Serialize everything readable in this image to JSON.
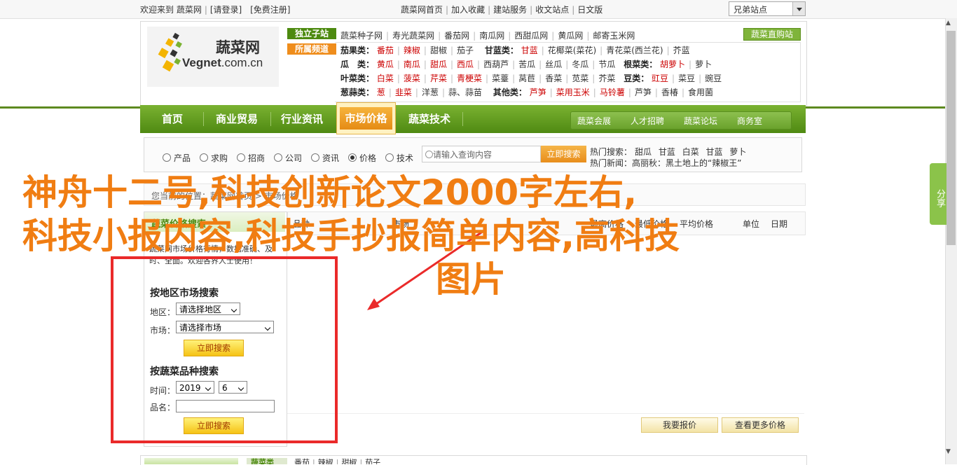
{
  "topbar": {
    "welcome": "欢迎来到 蔬菜网",
    "login": "[请登录]",
    "register": "[免费注册]",
    "links": [
      "蔬菜网首页",
      "加入收藏",
      "建站服务",
      "收文站点",
      "日文版"
    ],
    "lang_select": "兄弟站点"
  },
  "logo": {
    "cn": "蔬菜网",
    "en_a": "Vegnet",
    "en_b": ".com.cn",
    "reg": "®"
  },
  "header": {
    "tab_featured": "独立子站",
    "tab_channel": "所属频道",
    "direct": "蔬菜直购站",
    "row0": [
      "蔬菜种子网",
      "寿光蔬菜网",
      "番茄网",
      "南瓜网",
      "西甜瓜网",
      "黄瓜网",
      "邮寄玉米网"
    ],
    "rows": [
      {
        "label": "茄果类：",
        "items": [
          "番茄",
          "辣椒",
          "甜椒",
          "茄子"
        ],
        "label2": "甘蓝类：",
        "items2": [
          "甘蓝",
          "花椰菜(菜花)",
          "青花菜(西兰花)",
          "芥蓝"
        ]
      },
      {
        "label": "瓜　类：",
        "items": [
          "黄瓜",
          "南瓜",
          "甜瓜",
          "西瓜",
          "西葫芦",
          "苦瓜",
          "丝瓜",
          "冬瓜",
          "节瓜"
        ],
        "label2": "根菜类：",
        "items2": [
          "胡萝卜",
          "萝卜"
        ]
      },
      {
        "label": "叶菜类：",
        "items": [
          "白菜",
          "菠菜",
          "芹菜",
          "青梗菜",
          "菜薹",
          "莴苣",
          "香菜",
          "苋菜",
          "芥菜"
        ],
        "label2": "豆类：",
        "items2": [
          "豇豆",
          "菜豆",
          "豌豆"
        ]
      },
      {
        "label": "葱蒜类：",
        "items": [
          "葱",
          "韭菜",
          "洋葱",
          "蒜、蒜苗"
        ],
        "label2": "其他类：",
        "items2": [
          "芦笋",
          "菜用玉米",
          "马铃薯",
          "芦笋",
          "香椿",
          "食用菌"
        ]
      }
    ]
  },
  "nav": {
    "items": [
      "首页",
      "商业贸易",
      "行业资讯",
      "市场价格",
      "蔬菜技术"
    ],
    "active": "市场价格",
    "sub": [
      "蔬菜会展",
      "人才招聘",
      "蔬菜论坛",
      "商务室"
    ]
  },
  "search": {
    "radios": [
      "产品",
      "求购",
      "招商",
      "公司",
      "资讯",
      "价格",
      "技术"
    ],
    "selected": "价格",
    "placeholder": "请输入查询内容",
    "button": "立即搜索",
    "hot_label": "热门搜索：",
    "hot_items": [
      "甜瓜",
      "甘蓝",
      "白菜",
      "甘蓝",
      "萝卜"
    ],
    "news_label": "热门新闻：",
    "news_text": "高丽秋：黑土地上的“辣椒王”"
  },
  "breadcrumb": "您当前的位置：蔬菜网首页 > 市场价格",
  "left": {
    "header": "蔬菜价格搜索",
    "intro": "蔬菜网市场价格行情，数据准确、及时、全面。欢迎各界人士使用！",
    "region_title": "按地区市场搜索",
    "region_label": "地区：",
    "region_value": "请选择地区",
    "market_label": "市场：",
    "market_value": "请选择市场",
    "button": "立即搜索",
    "variety_title": "按蔬菜品种搜索",
    "time_label": "时间：",
    "year": "2019",
    "month": "6",
    "name_label": "品名："
  },
  "table": {
    "headers": [
      "品种",
      "市场",
      "最高价格",
      "最低价格",
      "平均价格",
      "单位",
      "日期"
    ],
    "buttons": [
      "我要报价",
      "查看更多价格"
    ]
  },
  "bottom": {
    "tab": "蔬菜类",
    "items": [
      "番茄",
      "辣椒",
      "甜椒",
      "茄子"
    ]
  },
  "share": "分享",
  "overlay": {
    "line1": "神舟十二号,科技创新论文2000字左右,",
    "line2": "科技小报内容,科技手抄报简单内容,高科技",
    "line3": "图片",
    "color": "#f07d12",
    "box_color": "#ea2a2a"
  }
}
